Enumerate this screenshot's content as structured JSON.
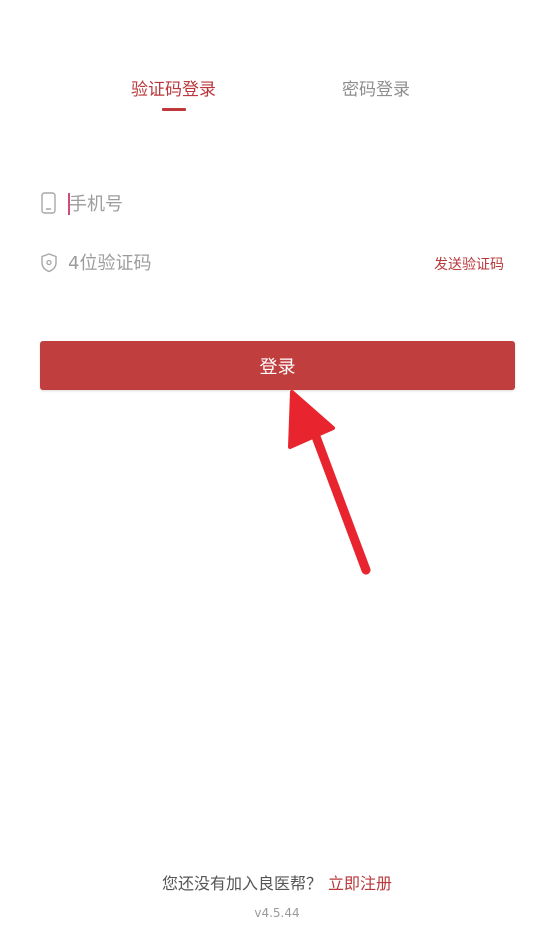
{
  "tabs": {
    "sms_login": "验证码登录",
    "password_login": "密码登录",
    "active": "sms_login"
  },
  "form": {
    "phone_placeholder": "手机号",
    "code_placeholder": "4位验证码",
    "send_code_label": "发送验证码",
    "login_label": "登录"
  },
  "footer": {
    "prompt": "您还没有加入良医帮？",
    "register_label": "立即注册",
    "version": "v4.5.44"
  },
  "colors": {
    "accent": "#c13e3f",
    "text_accent": "#b8383b",
    "inactive_tab": "#8e8e8e",
    "placeholder": "#9c9c9c",
    "annotation_arrow": "#e8252f"
  },
  "icons": {
    "phone": "phone-icon",
    "shield": "shield-icon"
  }
}
